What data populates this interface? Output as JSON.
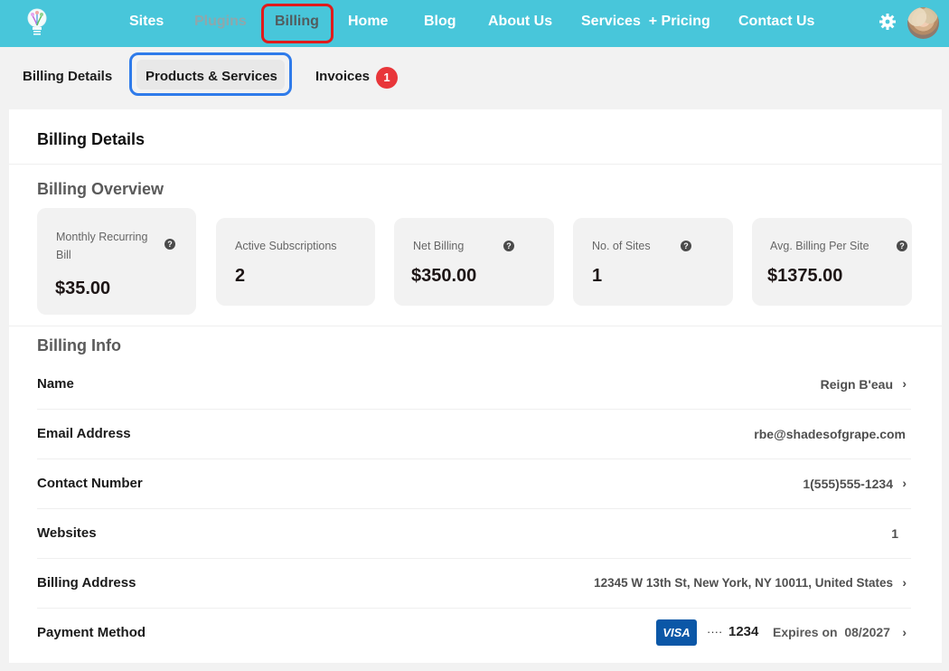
{
  "topnav": {
    "items": [
      {
        "label": "Sites",
        "state": "normal"
      },
      {
        "label": "Plugins",
        "state": "disabled"
      },
      {
        "label": "Billing",
        "state": "active"
      },
      {
        "label": "Home",
        "state": "normal"
      },
      {
        "label": "Blog",
        "state": "normal"
      },
      {
        "label": "About Us",
        "state": "normal"
      },
      {
        "label": "Services  + Pricing",
        "state": "normal"
      },
      {
        "label": "Contact Us",
        "state": "normal"
      }
    ],
    "icons": {
      "logo": "lightbulb-logo-icon",
      "settings": "gear-icon",
      "avatar": "user-avatar"
    },
    "colors": {
      "bar": "#48c6da",
      "active_highlight": "#e01b1b"
    }
  },
  "subnav": {
    "items": [
      {
        "label": "Billing Details"
      },
      {
        "label": "Products & Services",
        "highlighted": true
      },
      {
        "label": "Invoices",
        "badge": "1"
      }
    ],
    "colors": {
      "highlight": "#2f7bea",
      "badge": "#e8363a"
    }
  },
  "main": {
    "title": "Billing Details",
    "overview": {
      "title": "Billing Overview",
      "cards": [
        {
          "label": "Monthly Recurring Bill",
          "value": "$35.00",
          "help": true
        },
        {
          "label": "Active Subscriptions",
          "value": "2",
          "help": false
        },
        {
          "label": "Net Billing",
          "value": "$350.00",
          "help": true
        },
        {
          "label": "No. of Sites",
          "value": "1",
          "help": true
        },
        {
          "label": "Avg. Billing Per Site",
          "value": "$1375.00",
          "help": true
        }
      ],
      "help_glyph": "?"
    },
    "info": {
      "title": "Billing Info",
      "rows": [
        {
          "label": "Name",
          "value": "Reign B'eau",
          "chevron": true
        },
        {
          "label": "Email Address",
          "value": "rbe@shadesofgrape.com",
          "chevron": false
        },
        {
          "label": "Contact Number",
          "value": "1(555)555-1234",
          "chevron": true
        },
        {
          "label": "Websites",
          "value": "1",
          "chevron": false
        },
        {
          "label": "Billing Address",
          "value": "12345 W 13th St, New York, NY 10011, United States",
          "chevron": true
        },
        {
          "label": "Payment Method",
          "chevron": true
        }
      ],
      "payment": {
        "brand": "VISA",
        "masked": "····",
        "last4": "1234",
        "expires": "Expires on  08/2027",
        "brand_color": "#0b57a7"
      },
      "chevron_glyph": "›"
    }
  }
}
